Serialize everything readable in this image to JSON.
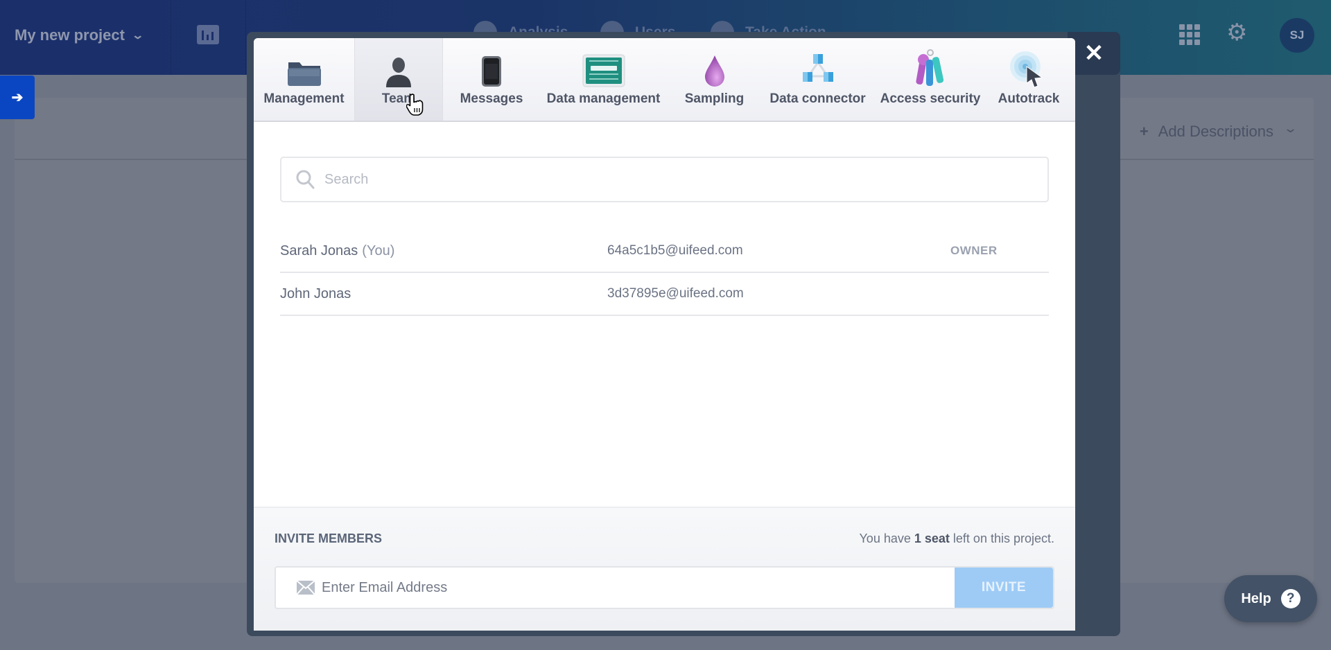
{
  "topbar": {
    "project_name": "My new project",
    "nav": [
      {
        "label": "Analysis",
        "icon": "analysis-icon"
      },
      {
        "label": "Users",
        "icon": "users-icon"
      },
      {
        "label": "Take Action",
        "icon": "take-action-icon"
      }
    ],
    "avatar_initials": "SJ"
  },
  "sidebar_toggle": {
    "icon": "arrow-right-icon",
    "glyph": "➔"
  },
  "content": {
    "add_descriptions": "Add Descriptions"
  },
  "help": {
    "label": "Help",
    "glyph": "?"
  },
  "modal": {
    "close_glyph": "✕",
    "active_tab": "Team",
    "tabs": [
      {
        "label": "Management",
        "icon": "folder-icon"
      },
      {
        "label": "Team",
        "icon": "person-icon"
      },
      {
        "label": "Messages",
        "icon": "phone-icon"
      },
      {
        "label": "Data management",
        "icon": "data-display-icon"
      },
      {
        "label": "Sampling",
        "icon": "droplet-icon"
      },
      {
        "label": "Data connector",
        "icon": "cubes-icon"
      },
      {
        "label": "Access security",
        "icon": "keys-icon"
      },
      {
        "label": "Autotrack",
        "icon": "target-cursor-icon"
      }
    ],
    "search": {
      "placeholder": "Search",
      "value": ""
    },
    "members": [
      {
        "name": "Sarah Jonas",
        "suffix": "(You)",
        "email": "64a5c1b5@uifeed.com",
        "role": "OWNER"
      },
      {
        "name": "John Jonas",
        "suffix": "",
        "email": "3d37895e@uifeed.com",
        "role": ""
      }
    ],
    "invite": {
      "title": "INVITE MEMBERS",
      "seats_prefix": "You have ",
      "seats_bold": "1 seat",
      "seats_suffix": " left on this project.",
      "email_placeholder": "Enter Email Address",
      "email_value": "",
      "button_label": "INVITE"
    }
  },
  "colors": {
    "topbar_start": "#1b2f6b",
    "topbar_end": "#1f5b6e",
    "sidebar_toggle": "#0b46c2",
    "invite_button": "#9ecbf6",
    "help_button": "#435266"
  }
}
